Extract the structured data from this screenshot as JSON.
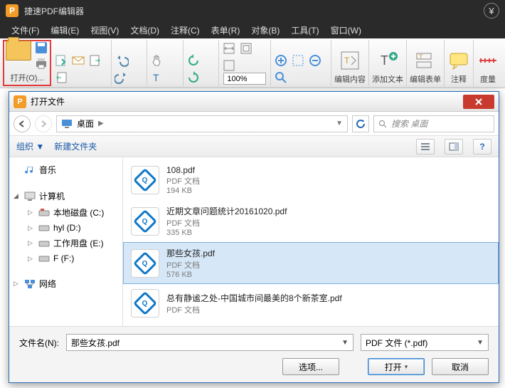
{
  "app": {
    "icon_letter": "P",
    "title": "捷速PDF编辑器",
    "yen": "¥"
  },
  "menu": [
    "文件(F)",
    "编辑(E)",
    "视图(V)",
    "文档(D)",
    "注释(C)",
    "表单(R)",
    "对象(B)",
    "工具(T)",
    "窗口(W)"
  ],
  "ribbon": {
    "open_label": "打开(O)...",
    "zoom": "100%",
    "group_labels": {
      "edit": "编辑内容",
      "add_text": "添加文本",
      "edit_form": "编辑表单",
      "annotate": "注释",
      "measure": "度量"
    }
  },
  "dialog": {
    "title": "打开文件",
    "breadcrumb": {
      "location": "桌面"
    },
    "search_placeholder": "搜索 桌面",
    "toolbar": {
      "organize": "组织",
      "new_folder": "新建文件夹"
    },
    "tree": {
      "music": "音乐",
      "computer": "计算机",
      "drives": [
        "本地磁盘 (C:)",
        "hyl (D:)",
        "工作用盘 (E:)",
        "F (F:)"
      ],
      "network": "网络"
    },
    "files": [
      {
        "name": "108.pdf",
        "type": "PDF 文档",
        "size": "194 KB"
      },
      {
        "name": "近期文章问题统计20161020.pdf",
        "type": "PDF 文档",
        "size": "335 KB"
      },
      {
        "name": "那些女孩.pdf",
        "type": "PDF 文档",
        "size": "576 KB"
      },
      {
        "name": "总有静谧之处-中国城市间最美的8个新茶室.pdf",
        "type": "PDF 文档",
        "size": ""
      }
    ],
    "selected_index": 2,
    "footer": {
      "filename_label": "文件名(N):",
      "filename_value": "那些女孩.pdf",
      "filter": "PDF 文件 (*.pdf)",
      "options": "选项...",
      "open": "打开",
      "cancel": "取消"
    }
  }
}
